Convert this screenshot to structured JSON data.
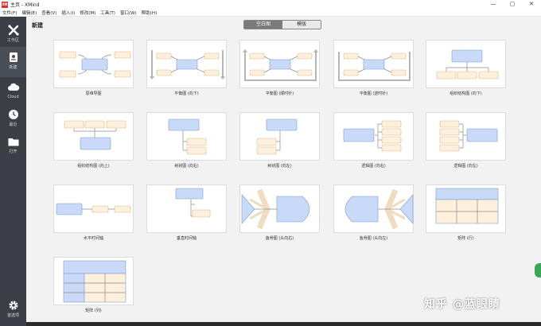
{
  "window": {
    "app_icon": "XM",
    "title": "主页 - XMind",
    "controls": [
      "—",
      "▢",
      "✕"
    ]
  },
  "menu": [
    "文件(F)",
    "编辑(E)",
    "查看(V)",
    "插入(I)",
    "修改(M)",
    "工具(T)",
    "窗口(W)",
    "帮助(H)"
  ],
  "sidebar": {
    "items": [
      {
        "label": "工作区",
        "icon": "cross-icon"
      },
      {
        "label": "新建",
        "icon": "new-doc-icon"
      },
      {
        "label": "Cloud",
        "icon": "cloud-icon"
      },
      {
        "label": "最近",
        "icon": "clock-icon"
      },
      {
        "label": "打开",
        "icon": "folder-icon"
      }
    ],
    "bottom": {
      "label": "首选项",
      "icon": "gear-icon"
    }
  },
  "header": {
    "title": "新建",
    "tabs": [
      "空白图",
      "模版"
    ],
    "active_tab": 0
  },
  "templates": [
    "思维导图",
    "平衡图 (向下)",
    "平衡图 (顺时针)",
    "平衡图 (逆时针)",
    "组织结构图 (向下)",
    "组织结构图 (向上)",
    "树状图 (向右)",
    "树状图 (向左)",
    "逻辑图 (向右)",
    "逻辑图 (向左)",
    "水平时间轴",
    "垂直时间轴",
    "鱼骨图 (头向右)",
    "鱼骨图 (头向左)",
    "矩阵 (行)",
    "矩阵 (列)"
  ],
  "colors": {
    "blue_fill": "#c9daf8",
    "blue_stroke": "#7e9ccc",
    "beige_fill": "#fdf0dc",
    "beige_stroke": "#d9b98a",
    "line": "#8c8c8c"
  },
  "watermark": "知乎 @蓝眼睛"
}
